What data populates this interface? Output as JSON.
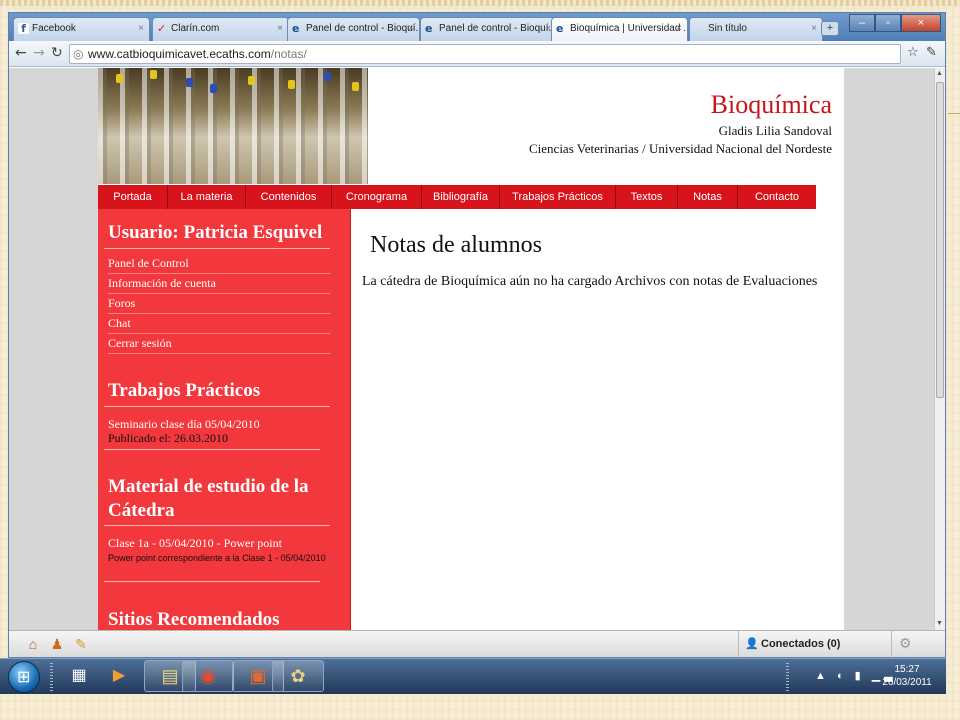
{
  "browser": {
    "tabs": [
      {
        "label": "Facebook",
        "icon": "facebook-icon"
      },
      {
        "label": "Clarín.com",
        "icon": "clarin-icon"
      },
      {
        "label": "Panel de control - Bioquí...",
        "icon": "e-site-icon"
      },
      {
        "label": "Panel de control - Bioquí...",
        "icon": "e-site-icon"
      },
      {
        "label": "Bioquímica | Universidad ...",
        "icon": "e-site-icon"
      },
      {
        "label": "Sin título",
        "icon": ""
      }
    ],
    "active_tab": 4,
    "url_host": "www.catbioquimicavet.ecaths.com",
    "url_path": "/notas/"
  },
  "site": {
    "title": "Bioquímica",
    "author": "Gladis Lilia Sandoval",
    "affiliation": "Ciencias Veterinarias / Universidad Nacional del Nordeste"
  },
  "nav": [
    "Portada",
    "La materia",
    "Contenidos",
    "Cronograma",
    "Bibliografía",
    "Trabajos Prácticos",
    "Textos",
    "Notas",
    "Contacto"
  ],
  "sidebar": {
    "user_heading": "Usuario: Patricia Esquivel",
    "user_links": [
      "Panel de Control",
      "Información de cuenta",
      "Foros",
      "Chat",
      "Cerrar sesión"
    ],
    "tp_heading": "Trabajos Prácticos",
    "tp_item": "Seminario clase día 05/04/2010",
    "tp_published": "Publicado el: 26.03.2010",
    "material_heading_1": "Material de estudio de la",
    "material_heading_2": "Cátedra",
    "material_item": "Clase 1a - 05/04/2010 - Power point",
    "material_desc": "Power point correspondiente a la Clase 1 - 05/04/2010",
    "sites_heading": "Sitios Recomendados"
  },
  "content": {
    "title": "Notas de alumnos",
    "message": "La cátedra de Bioquímica aún no ha cargado Archivos con notas de Evaluaciones"
  },
  "chat": {
    "status": "Conectados (0)"
  },
  "taskbar": {
    "time": "15:27",
    "date": "26/03/2011"
  },
  "colors": {
    "brand_red": "#d7141c",
    "sidebar_red": "#f2373d",
    "title_red": "#c8141b"
  }
}
